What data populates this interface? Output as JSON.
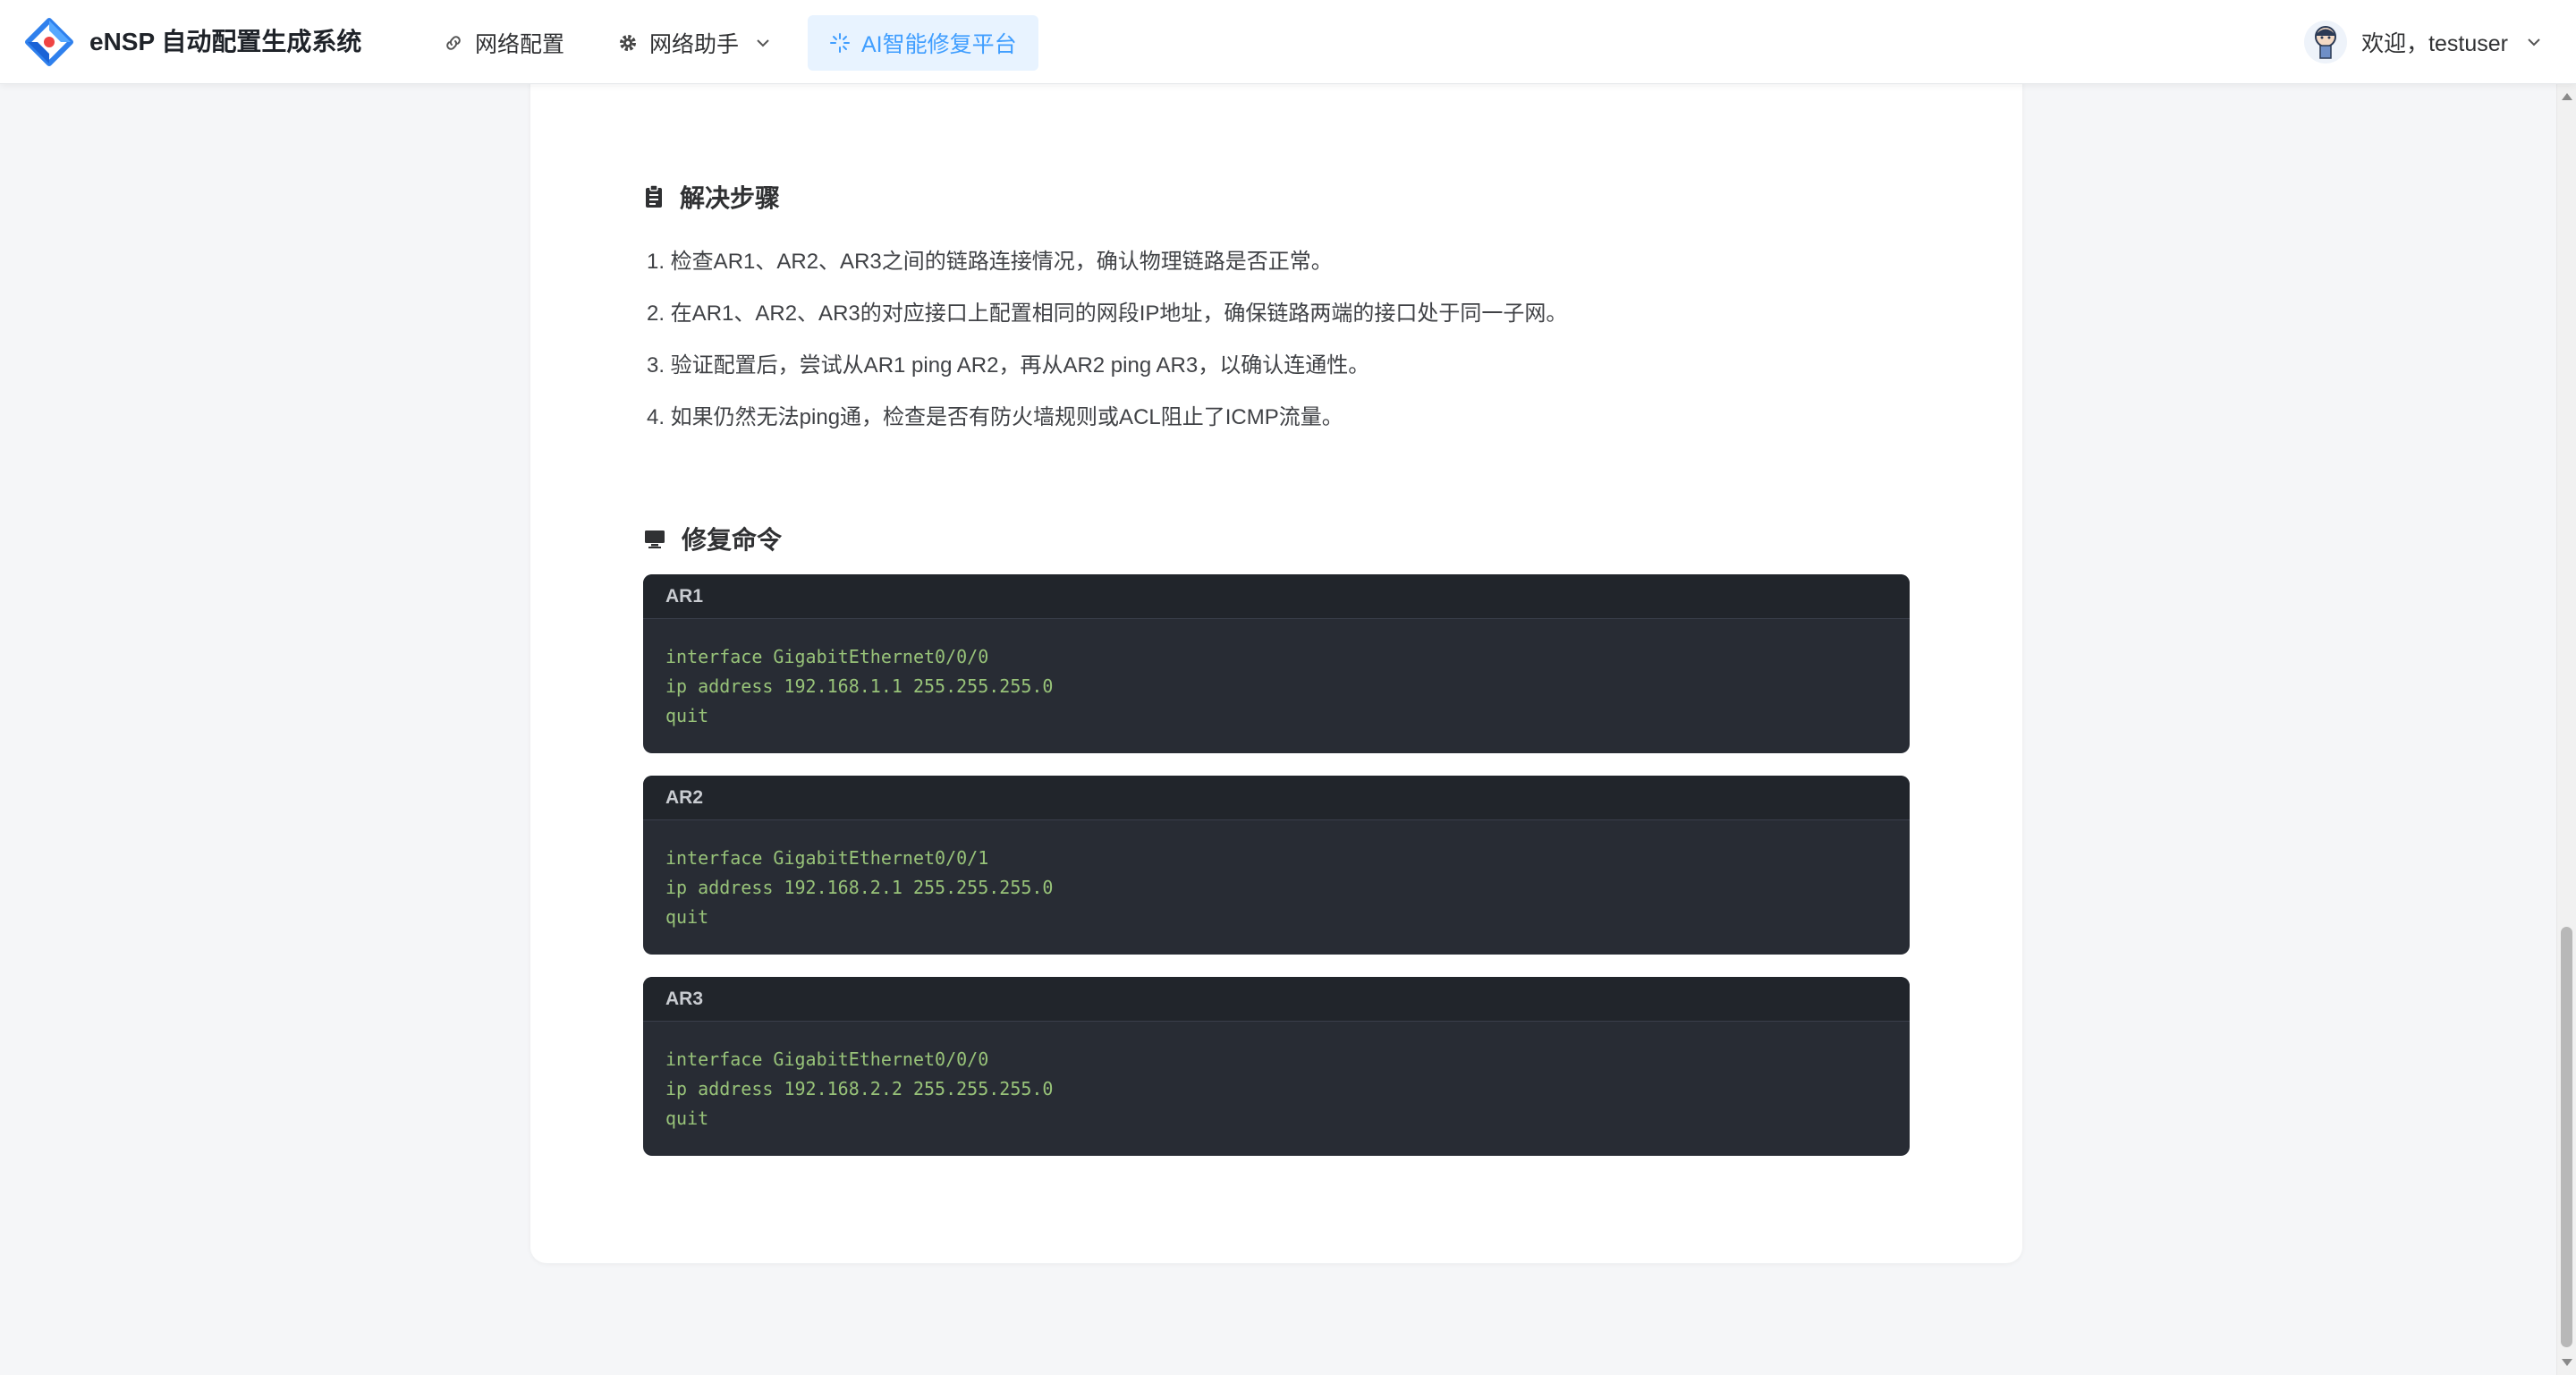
{
  "header": {
    "app_title": "eNSP 自动配置生成系统",
    "nav": [
      {
        "label": "网络配置",
        "icon": "link-icon"
      },
      {
        "label": "网络助手",
        "icon": "gear-icon"
      },
      {
        "label": "AI智能修复平台",
        "icon": "sparkle-icon",
        "active": true
      }
    ],
    "user_greeting": "欢迎，testuser"
  },
  "colors": {
    "accent": "#409eff",
    "code_bg": "#282c34",
    "code_header_bg": "#21252b",
    "code_text": "#98c379"
  },
  "solution": {
    "title": "解决步骤",
    "steps": [
      "1. 检查AR1、AR2、AR3之间的链路连接情况，确认物理链路是否正常。",
      "2. 在AR1、AR2、AR3的对应接口上配置相同的网段IP地址，确保链路两端的接口处于同一子网。",
      "3. 验证配置后，尝试从AR1 ping AR2，再从AR2 ping AR3，以确认连通性。",
      "4. 如果仍然无法ping通，检查是否有防火墙规则或ACL阻止了ICMP流量。"
    ]
  },
  "repair": {
    "title": "修复命令",
    "blocks": [
      {
        "device": "AR1",
        "lines": [
          "interface GigabitEthernet0/0/0",
          "ip address 192.168.1.1 255.255.255.0",
          "quit"
        ]
      },
      {
        "device": "AR2",
        "lines": [
          "interface GigabitEthernet0/0/1",
          "ip address 192.168.2.1 255.255.255.0",
          "quit"
        ]
      },
      {
        "device": "AR3",
        "lines": [
          "interface GigabitEthernet0/0/0",
          "ip address 192.168.2.2 255.255.255.0",
          "quit"
        ]
      }
    ]
  }
}
